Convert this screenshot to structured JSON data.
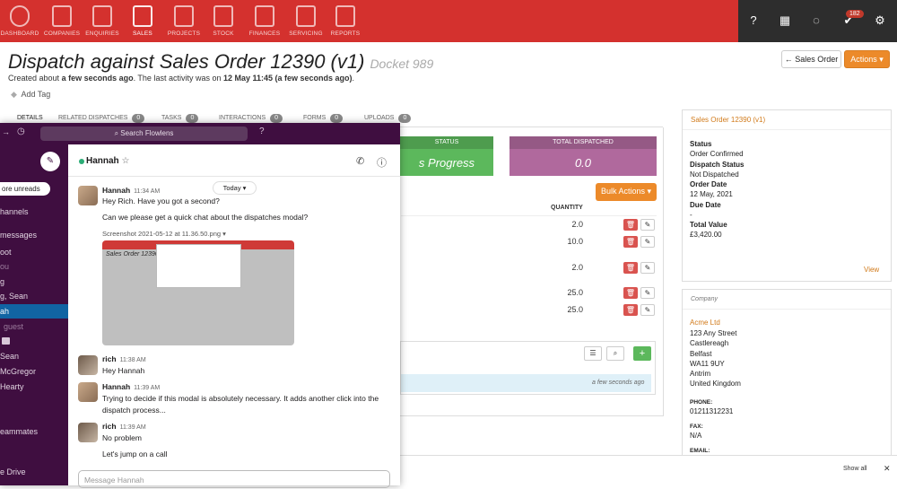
{
  "nav": {
    "items": [
      {
        "label": "DASHBOARD",
        "icon": "dashboard-icon"
      },
      {
        "label": "COMPANIES",
        "icon": "companies-icon"
      },
      {
        "label": "ENQUIRIES",
        "icon": "enquiries-icon"
      },
      {
        "label": "SALES",
        "icon": "sales-icon"
      },
      {
        "label": "PROJECTS",
        "icon": "projects-icon"
      },
      {
        "label": "STOCK",
        "icon": "stock-icon"
      },
      {
        "label": "FINANCES",
        "icon": "finances-icon"
      },
      {
        "label": "SERVICING",
        "icon": "servicing-icon"
      },
      {
        "label": "REPORTS",
        "icon": "reports-icon"
      }
    ],
    "notification_count": "182"
  },
  "page": {
    "title": "Dispatch against Sales Order 12390 (v1)",
    "docket": "Docket 989",
    "created_prefix": "Created about",
    "created_rel": "a few seconds ago",
    "last_activity_prefix": ". The last activity was on",
    "last_activity": "12 May 11:45 (a few seconds ago)",
    "add_tag": "Add Tag",
    "sales_order_button": "← Sales Order",
    "actions_button": "Actions ▾"
  },
  "tabs": [
    {
      "label": "DETAILS",
      "count": ""
    },
    {
      "label": "RELATED DISPATCHES",
      "count": "0"
    },
    {
      "label": "TASKS",
      "count": "0"
    },
    {
      "label": "INTERACTIONS",
      "count": "0"
    },
    {
      "label": "FORMS",
      "count": "0"
    },
    {
      "label": "UPLOADS",
      "count": "0"
    }
  ],
  "status": {
    "status_header": "STATUS",
    "status_value": "s Progress",
    "total_header": "TOTAL DISPATCHED",
    "total_value": "0.0",
    "bulk_actions": "Bulk Actions ▾",
    "quantity_header": "QUANTITY",
    "quantities": [
      "2.0",
      "10.0",
      "2.0",
      "25.0",
      "25.0"
    ],
    "time_ago": "a few seconds ago"
  },
  "sales_order_card": {
    "header": "Sales Order 12390 (v1)",
    "status_label": "Status",
    "status_value": "Order Confirmed",
    "dispatch_status_label": "Dispatch Status",
    "dispatch_status_value": "Not Dispatched",
    "order_date_label": "Order Date",
    "order_date_value": "12 May, 2021",
    "due_date_label": "Due Date",
    "due_date_value": "-",
    "total_value_label": "Total Value",
    "total_value_value": "£3,420.00",
    "view_link": "View"
  },
  "company_card": {
    "header": "Company",
    "name": "Acme Ltd",
    "address": [
      "123 Any Street",
      "Castlereagh",
      "Belfast",
      "WA11 9UY",
      "Antrim",
      "United Kingdom"
    ],
    "phone_label": "PHONE:",
    "phone": "01211312231",
    "fax_label": "FAX:",
    "fax": "N/A",
    "email_label": "EMAIL:"
  },
  "footer": {
    "show_all": "Show all",
    "close": "✕"
  },
  "slack": {
    "search_placeholder": "Search Flowlens",
    "channel_name": "Hannah",
    "more_unreads": "ore unreads",
    "sidebar": [
      "hannels",
      "messages",
      "oot",
      "ou",
      "g",
      "g, Sean",
      "ah",
      "guest",
      "",
      "Sean",
      "McGregor",
      "Hearty",
      "eammates",
      "e Drive"
    ],
    "today": "Today ▾",
    "messages": [
      {
        "author": "Hannah",
        "time": "11:34 AM",
        "lines": [
          "Hey Rich. Have you got a second?",
          "Can we please get a quick chat about the dispatches modal?"
        ]
      },
      {
        "author": "rich",
        "time": "11:38 AM",
        "lines": [
          "Hey Hannah"
        ]
      },
      {
        "author": "Hannah",
        "time": "11:39 AM",
        "lines": [
          "Trying to decide if this modal is absolutely necessary. It adds another click into the",
          "dispatch process..."
        ]
      },
      {
        "author": "rich",
        "time": "11:39 AM",
        "lines": [
          "No problem",
          "Let's jump on a call"
        ]
      }
    ],
    "attachment": "Screenshot 2021-05-12 at 11.36.50.png ▾",
    "thumb_title": "Sales Order 12390 (v1)",
    "message_placeholder": "Message Hannah"
  },
  "colors": {
    "nav_red": "#d4312e",
    "accent_orange": "#ec8a2a",
    "status_green": "#5cb85c",
    "total_purple": "#b0699d",
    "slack_purple": "#3f0e40"
  }
}
